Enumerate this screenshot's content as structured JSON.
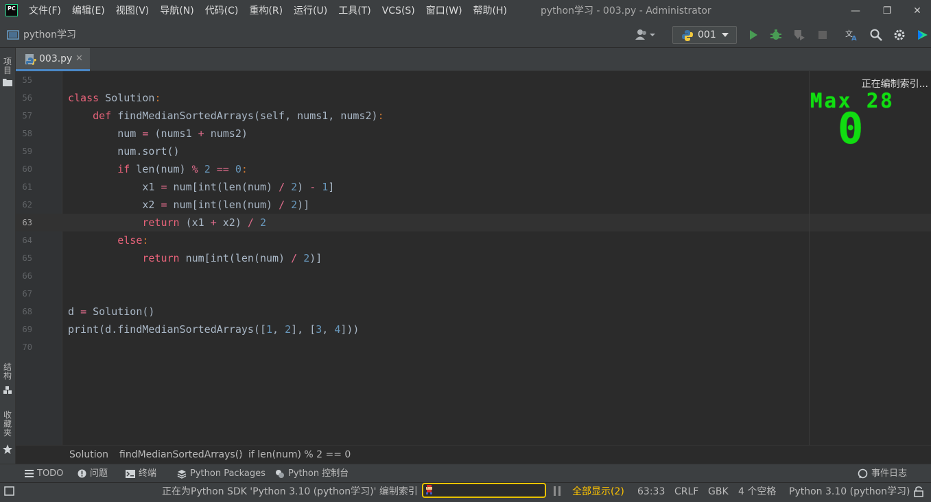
{
  "window": {
    "title": "python学习 - 003.py - Administrator",
    "minimize": "—",
    "restore": "❐",
    "close": "✕"
  },
  "menu": [
    "文件(F)",
    "编辑(E)",
    "视图(V)",
    "导航(N)",
    "代码(C)",
    "重构(R)",
    "运行(U)",
    "工具(T)",
    "VCS(S)",
    "窗口(W)",
    "帮助(H)"
  ],
  "app_logo": "PC",
  "toolbar": {
    "project_name": "python学习",
    "run_config": "001",
    "icons": [
      "account-icon",
      "run-icon",
      "debug-icon",
      "coverage-icon",
      "stop-icon",
      "translate-icon",
      "search-icon",
      "settings-icon",
      "update-icon"
    ]
  },
  "left_bar": {
    "project": "项目",
    "structure": "结构",
    "favorites": "收藏夹"
  },
  "tab": {
    "label": "003.py",
    "close": "✕"
  },
  "editor": {
    "indexing_label": "正在编制索引...",
    "game_overlay": {
      "max_label": "Max 28",
      "score": "0"
    },
    "current_line": "63",
    "lines": [
      {
        "num": "55",
        "code": []
      },
      {
        "num": "56",
        "code": [
          {
            "t": "class ",
            "c": "kw2"
          },
          {
            "t": "Solution",
            "c": ""
          },
          {
            "t": ":",
            "c": "kw"
          }
        ]
      },
      {
        "num": "57",
        "code": [
          {
            "t": "    ",
            "c": ""
          },
          {
            "t": "def ",
            "c": "kw2"
          },
          {
            "t": "findMedianSortedArrays",
            "c": ""
          },
          {
            "t": "(self, nums1, nums2)",
            "c": ""
          },
          {
            "t": ":",
            "c": "kw"
          }
        ]
      },
      {
        "num": "58",
        "code": [
          {
            "t": "        num ",
            "c": ""
          },
          {
            "t": "=",
            "c": "op"
          },
          {
            "t": " (nums1 ",
            "c": ""
          },
          {
            "t": "+",
            "c": "op"
          },
          {
            "t": " nums2)",
            "c": ""
          }
        ]
      },
      {
        "num": "59",
        "code": [
          {
            "t": "        num.sort()",
            "c": ""
          }
        ]
      },
      {
        "num": "60",
        "code": [
          {
            "t": "        ",
            "c": ""
          },
          {
            "t": "if ",
            "c": "kw2"
          },
          {
            "t": "len(num) ",
            "c": ""
          },
          {
            "t": "%",
            "c": "op"
          },
          {
            "t": " ",
            "c": ""
          },
          {
            "t": "2",
            "c": "num"
          },
          {
            "t": " ",
            "c": ""
          },
          {
            "t": "==",
            "c": "op"
          },
          {
            "t": " ",
            "c": ""
          },
          {
            "t": "0",
            "c": "num"
          },
          {
            "t": ":",
            "c": "kw"
          }
        ]
      },
      {
        "num": "61",
        "code": [
          {
            "t": "            x1 ",
            "c": ""
          },
          {
            "t": "=",
            "c": "op"
          },
          {
            "t": " num[int(len(num) ",
            "c": ""
          },
          {
            "t": "/",
            "c": "op"
          },
          {
            "t": " ",
            "c": ""
          },
          {
            "t": "2",
            "c": "num"
          },
          {
            "t": ") ",
            "c": ""
          },
          {
            "t": "-",
            "c": "op"
          },
          {
            "t": " ",
            "c": ""
          },
          {
            "t": "1",
            "c": "num"
          },
          {
            "t": "]",
            "c": ""
          }
        ]
      },
      {
        "num": "62",
        "code": [
          {
            "t": "            x2 ",
            "c": ""
          },
          {
            "t": "=",
            "c": "op"
          },
          {
            "t": " num[int(len(num) ",
            "c": ""
          },
          {
            "t": "/",
            "c": "op"
          },
          {
            "t": " ",
            "c": ""
          },
          {
            "t": "2",
            "c": "num"
          },
          {
            "t": ")]",
            "c": ""
          }
        ]
      },
      {
        "num": "63",
        "code": [
          {
            "t": "            ",
            "c": ""
          },
          {
            "t": "return ",
            "c": "kw2"
          },
          {
            "t": "(x1 ",
            "c": ""
          },
          {
            "t": "+",
            "c": "op"
          },
          {
            "t": " x2) ",
            "c": ""
          },
          {
            "t": "/",
            "c": "op"
          },
          {
            "t": " ",
            "c": ""
          },
          {
            "t": "2",
            "c": "num"
          }
        ]
      },
      {
        "num": "64",
        "code": [
          {
            "t": "        ",
            "c": ""
          },
          {
            "t": "else",
            "c": "kw2"
          },
          {
            "t": ":",
            "c": "kw"
          }
        ]
      },
      {
        "num": "65",
        "code": [
          {
            "t": "            ",
            "c": ""
          },
          {
            "t": "return ",
            "c": "kw2"
          },
          {
            "t": "num[int(len(num) ",
            "c": ""
          },
          {
            "t": "/",
            "c": "op"
          },
          {
            "t": " ",
            "c": ""
          },
          {
            "t": "2",
            "c": "num"
          },
          {
            "t": ")]",
            "c": ""
          }
        ]
      },
      {
        "num": "66",
        "code": []
      },
      {
        "num": "67",
        "code": []
      },
      {
        "num": "68",
        "code": [
          {
            "t": "d ",
            "c": ""
          },
          {
            "t": "=",
            "c": "op"
          },
          {
            "t": " Solution()",
            "c": ""
          }
        ]
      },
      {
        "num": "69",
        "code": [
          {
            "t": "print(d.findMedianSortedArrays([",
            "c": ""
          },
          {
            "t": "1",
            "c": "num"
          },
          {
            "t": ", ",
            "c": ""
          },
          {
            "t": "2",
            "c": "num"
          },
          {
            "t": "], [",
            "c": ""
          },
          {
            "t": "3",
            "c": "num"
          },
          {
            "t": ", ",
            "c": ""
          },
          {
            "t": "4",
            "c": "num"
          },
          {
            "t": "]))",
            "c": ""
          }
        ]
      },
      {
        "num": "70",
        "code": []
      }
    ]
  },
  "breadcrumbs": [
    "Solution",
    "findMedianSortedArrays()",
    "if len(num) % 2 == 0"
  ],
  "tool_windows": {
    "todo": "TODO",
    "problems": "问题",
    "terminal": "终端",
    "packages": "Python Packages",
    "console": "Python 控制台",
    "event_log": "事件日志"
  },
  "status": {
    "indexing_message": "正在为Python SDK 'Python 3.10 (python学习)' 编制索引",
    "show_all": "全部显示(2)",
    "position": "63:33",
    "line_sep": "CRLF",
    "encoding": "GBK",
    "indent": "4 个空格",
    "interpreter": "Python 3.10 (python学习)"
  },
  "colors": {
    "accent_green": "#11dd11",
    "progress_border": "#e8c200",
    "tab_underline": "#4a88c7"
  }
}
